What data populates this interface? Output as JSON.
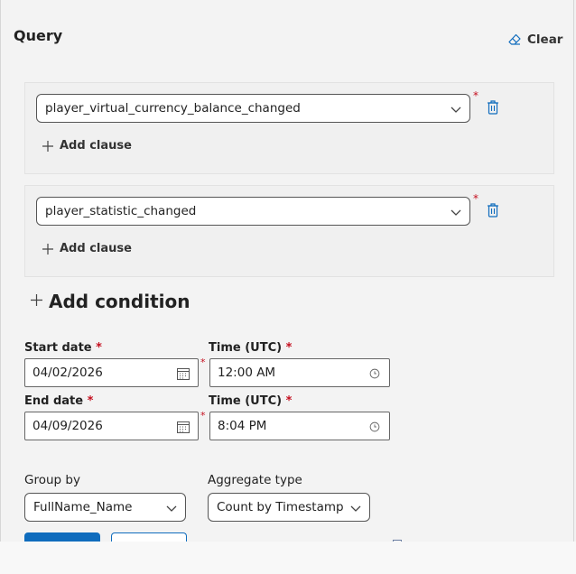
{
  "query": {
    "title": "Query",
    "clear_label": "Clear"
  },
  "clauses": [
    {
      "event": "player_virtual_currency_balance_changed",
      "add_clause_label": "Add clause"
    },
    {
      "event": "player_statistic_changed",
      "add_clause_label": "Add clause"
    }
  ],
  "add_condition_label": "Add condition",
  "required_marker": "*",
  "dates": {
    "start_label": "Start date",
    "start_value": "04/02/2026",
    "start_time_label": "Time (UTC)",
    "start_time_value": "12:00 AM",
    "end_label": "End date",
    "end_value": "04/09/2026",
    "end_time_label": "Time (UTC)",
    "end_time_value": "8:04 PM"
  },
  "group_by": {
    "label": "Group by",
    "value": "FullName_Name"
  },
  "aggregate": {
    "label": "Aggregate type",
    "value": "Count by Timestamp"
  },
  "colors": {
    "accent": "#0f6cbd",
    "required": "#c50f1f"
  }
}
